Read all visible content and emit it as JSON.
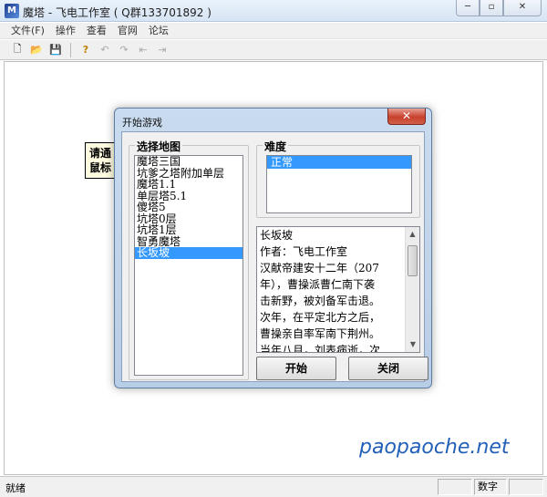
{
  "window": {
    "title": "魔塔 - 飞电工作室 ( Q群133701892 )",
    "app_icon": "tower-app-icon",
    "minimize": "─",
    "maximize": "▫",
    "close": "✕"
  },
  "menu": [
    {
      "label": "文件(F)"
    },
    {
      "label": "操作"
    },
    {
      "label": "查看"
    },
    {
      "label": "官网"
    },
    {
      "label": "论坛"
    }
  ],
  "toolbar": [
    {
      "icon": "new-file-icon",
      "glyph": "🗋",
      "enabled": true
    },
    {
      "icon": "open-folder-icon",
      "glyph": "📂",
      "enabled": true
    },
    {
      "icon": "save-icon",
      "glyph": "💾",
      "enabled": true
    },
    {
      "icon": "help-icon",
      "glyph": "?",
      "enabled": true
    },
    {
      "icon": "undo-icon",
      "glyph": "↶",
      "enabled": false
    },
    {
      "icon": "redo-icon",
      "glyph": "↷",
      "enabled": false
    },
    {
      "icon": "step-back-icon",
      "glyph": "⇤",
      "enabled": false
    },
    {
      "icon": "step-forward-icon",
      "glyph": "⇥",
      "enabled": false
    }
  ],
  "tip": {
    "line1": "请通",
    "line2": "鼠标"
  },
  "dialog": {
    "title": "开始游戏",
    "close": "✕",
    "map_group_label": "选择地图",
    "maps": [
      "魔塔三国",
      "坑爹之塔附加单层",
      "魔塔1.1",
      "单层塔5.1",
      "傻塔5",
      "坑塔0层",
      "坑塔1层",
      "智勇魔塔",
      "长坂坡"
    ],
    "selected_map": "长坂坡",
    "difficulty_label": "难度",
    "difficulties": [
      "正常"
    ],
    "selected_difficulty": "正常",
    "description": [
      "长坂坡",
      "作者：飞电工作室",
      "汉献帝建安十二年（207",
      "年），曹操派曹仁南下袭",
      "击新野，被刘备军击退。",
      "次年，在平定北方之后，",
      "曹操亲自率军南下荆州。",
      "当年八月，刘表病逝，次"
    ],
    "start_label": "开始",
    "close_label": "关闭"
  },
  "status": {
    "left": "就绪",
    "right": "数字"
  },
  "watermark": "paopaoche.net",
  "colors": {
    "selection": "#3399ff",
    "watermark": "#2360b8"
  }
}
